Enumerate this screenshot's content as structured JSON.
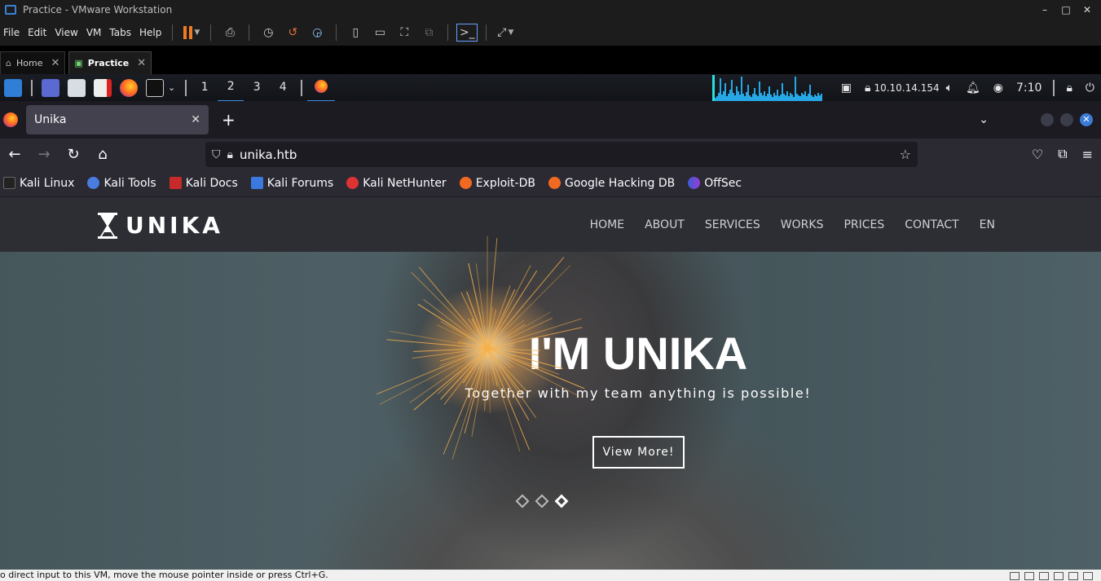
{
  "vmware": {
    "title": "Practice - VMware Workstation",
    "window_controls": [
      "–",
      "□",
      "✕"
    ],
    "menu": [
      "File",
      "Edit",
      "View",
      "VM",
      "Tabs",
      "Help"
    ],
    "tabs": [
      {
        "label": "Home",
        "icon": "home-icon"
      },
      {
        "label": "Practice",
        "icon": "vm-icon"
      }
    ],
    "status_text": "o direct input to this VM, move the mouse pointer inside or press Ctrl+G."
  },
  "kali_panel": {
    "workspaces": [
      "1",
      "2",
      "3",
      "4"
    ],
    "active_workspace": "2",
    "ip": "10.10.14.154",
    "clock": "7:10"
  },
  "firefox": {
    "tab_title": "Unika",
    "url": "unika.htb",
    "bookmarks": [
      "Kali Linux",
      "Kali Tools",
      "Kali Docs",
      "Kali Forums",
      "Kali NetHunter",
      "Exploit-DB",
      "Google Hacking DB",
      "OffSec"
    ]
  },
  "site": {
    "logo": "UNIKA",
    "menu": [
      "HOME",
      "ABOUT",
      "SERVICES",
      "WORKS",
      "PRICES",
      "CONTACT",
      "EN"
    ],
    "hero_title": "I'M UNIKA",
    "hero_subtitle": "Together with my team anything is possible!",
    "hero_button": "View More!",
    "slider_active_index": 2
  },
  "colors": {
    "pause_orange": "#f07b21",
    "kali_blue": "#3b8ee8",
    "site_nav_bg": "#2c2e33"
  }
}
